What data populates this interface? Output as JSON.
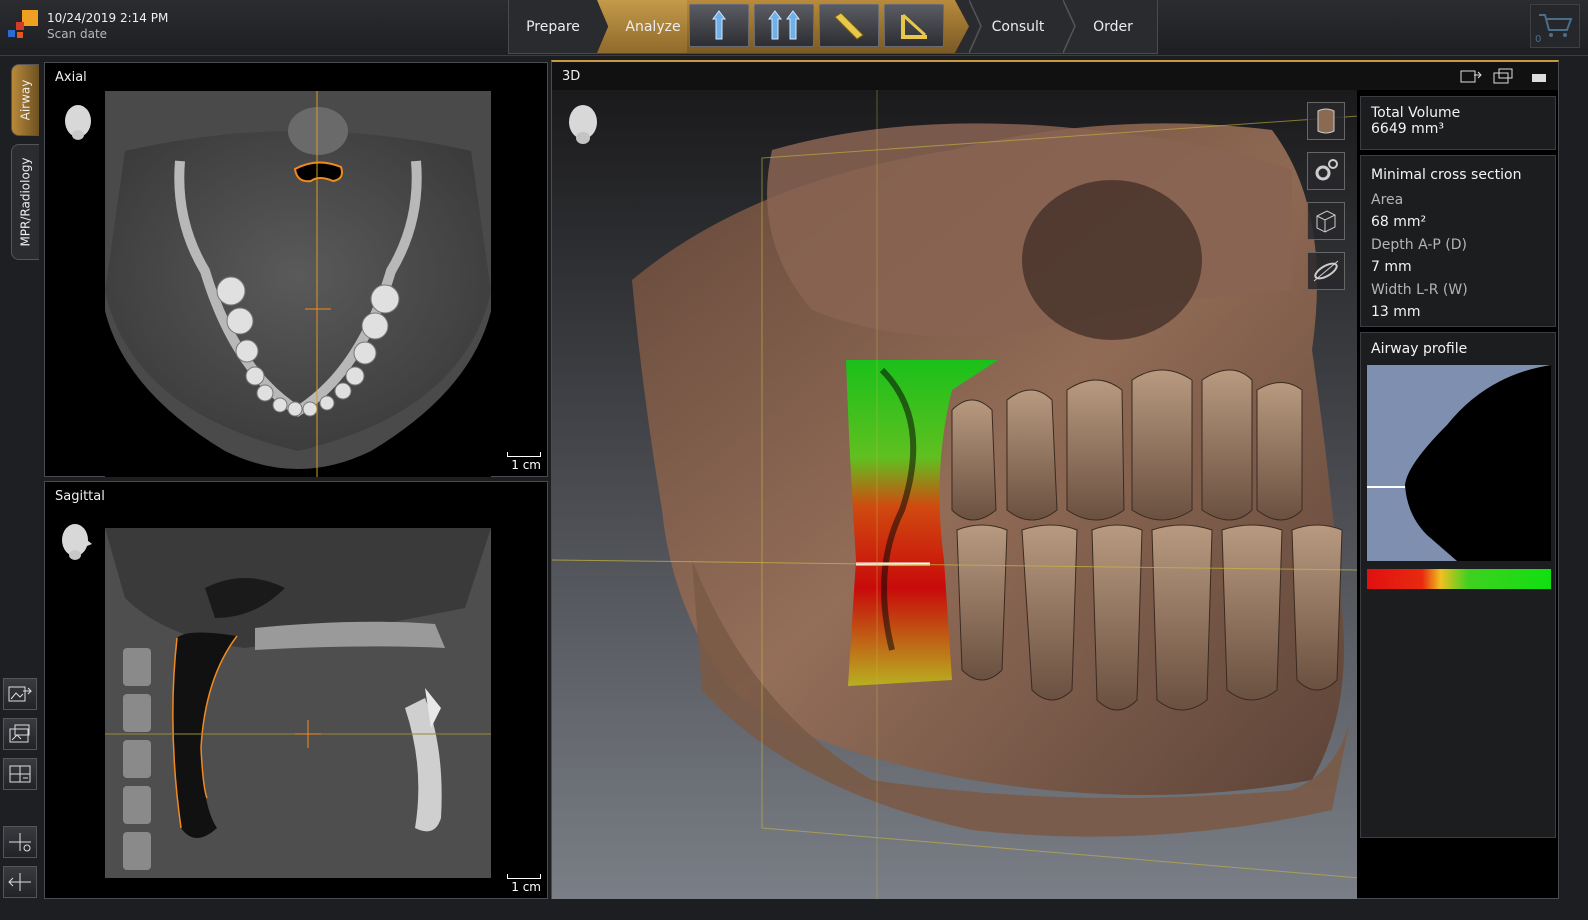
{
  "header": {
    "scan_date": "10/24/2019 2:14 PM",
    "scan_label": "Scan date",
    "workflow": {
      "prepare": "Prepare",
      "analyze": "Analyze",
      "consult": "Consult",
      "order": "Order"
    },
    "tools": [
      "airway-single-icon",
      "airway-double-icon",
      "ruler-icon",
      "angle-icon"
    ],
    "cart_count": "0"
  },
  "sidebar": {
    "tabs": [
      "Airway",
      "MPR/Radiology"
    ],
    "buttons": [
      "export-image-icon",
      "screenshot-icon",
      "layout-icon",
      "crosshair-view-icon",
      "crosshair-reset-icon"
    ]
  },
  "views": {
    "axial": {
      "title": "Axial",
      "scale": "1 cm"
    },
    "sagittal": {
      "title": "Sagittal",
      "scale": "1 cm"
    },
    "three_d": {
      "title": "3D"
    }
  },
  "measurements": {
    "total_volume_label": "Total Volume",
    "total_volume_value": "6649 mm³",
    "min_cross_title": "Minimal cross section",
    "area_label": "Area",
    "area_value": "68 mm²",
    "depth_label": "Depth A-P (D)",
    "depth_value": "7 mm",
    "width_label": "Width L-R (W)",
    "width_value": "13 mm",
    "airway_profile_title": "Airway profile"
  },
  "colors": {
    "accent": "#c89a45",
    "crosshair": "#d4a020",
    "airway_outline": "#f08a20",
    "profile_fill": "#7f8fb0"
  }
}
